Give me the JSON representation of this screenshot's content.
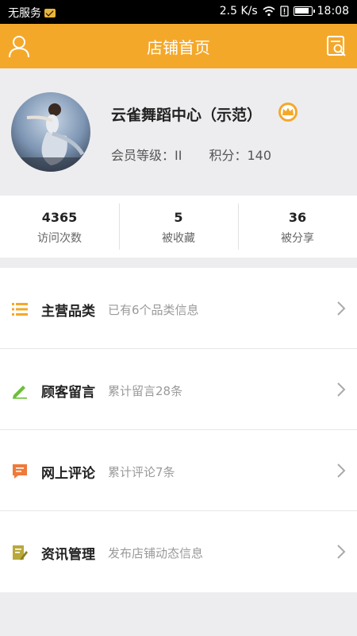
{
  "status_bar": {
    "carrier": "无服务",
    "speed": "2.5 K/s",
    "time": "18:08"
  },
  "header": {
    "title": "店铺首页",
    "left_icon": "user-icon",
    "right_icon": "search-report-icon"
  },
  "profile": {
    "shop_name": "云雀舞蹈中心（示范）",
    "member_level": "会员等级：II",
    "points": "积分：140"
  },
  "stats": [
    {
      "value": "4365",
      "label": "访问次数"
    },
    {
      "value": "5",
      "label": "被收藏"
    },
    {
      "value": "36",
      "label": "被分享"
    }
  ],
  "menu": [
    {
      "name": "主营品类",
      "desc": "已有6个品类信息",
      "icon": "list-icon",
      "color": "#f4a82a"
    },
    {
      "name": "顾客留言",
      "desc": "累计留言28条",
      "icon": "pencil-icon",
      "color": "#6cbf3a"
    },
    {
      "name": "网上评论",
      "desc": "累计评论7条",
      "icon": "comment-icon",
      "color": "#ef7a3a"
    },
    {
      "name": "资讯管理",
      "desc": "发布店铺动态信息",
      "icon": "edit-doc-icon",
      "color": "#b9a93a"
    }
  ],
  "colors": {
    "accent": "#f4a82a",
    "background": "#ededf0"
  }
}
